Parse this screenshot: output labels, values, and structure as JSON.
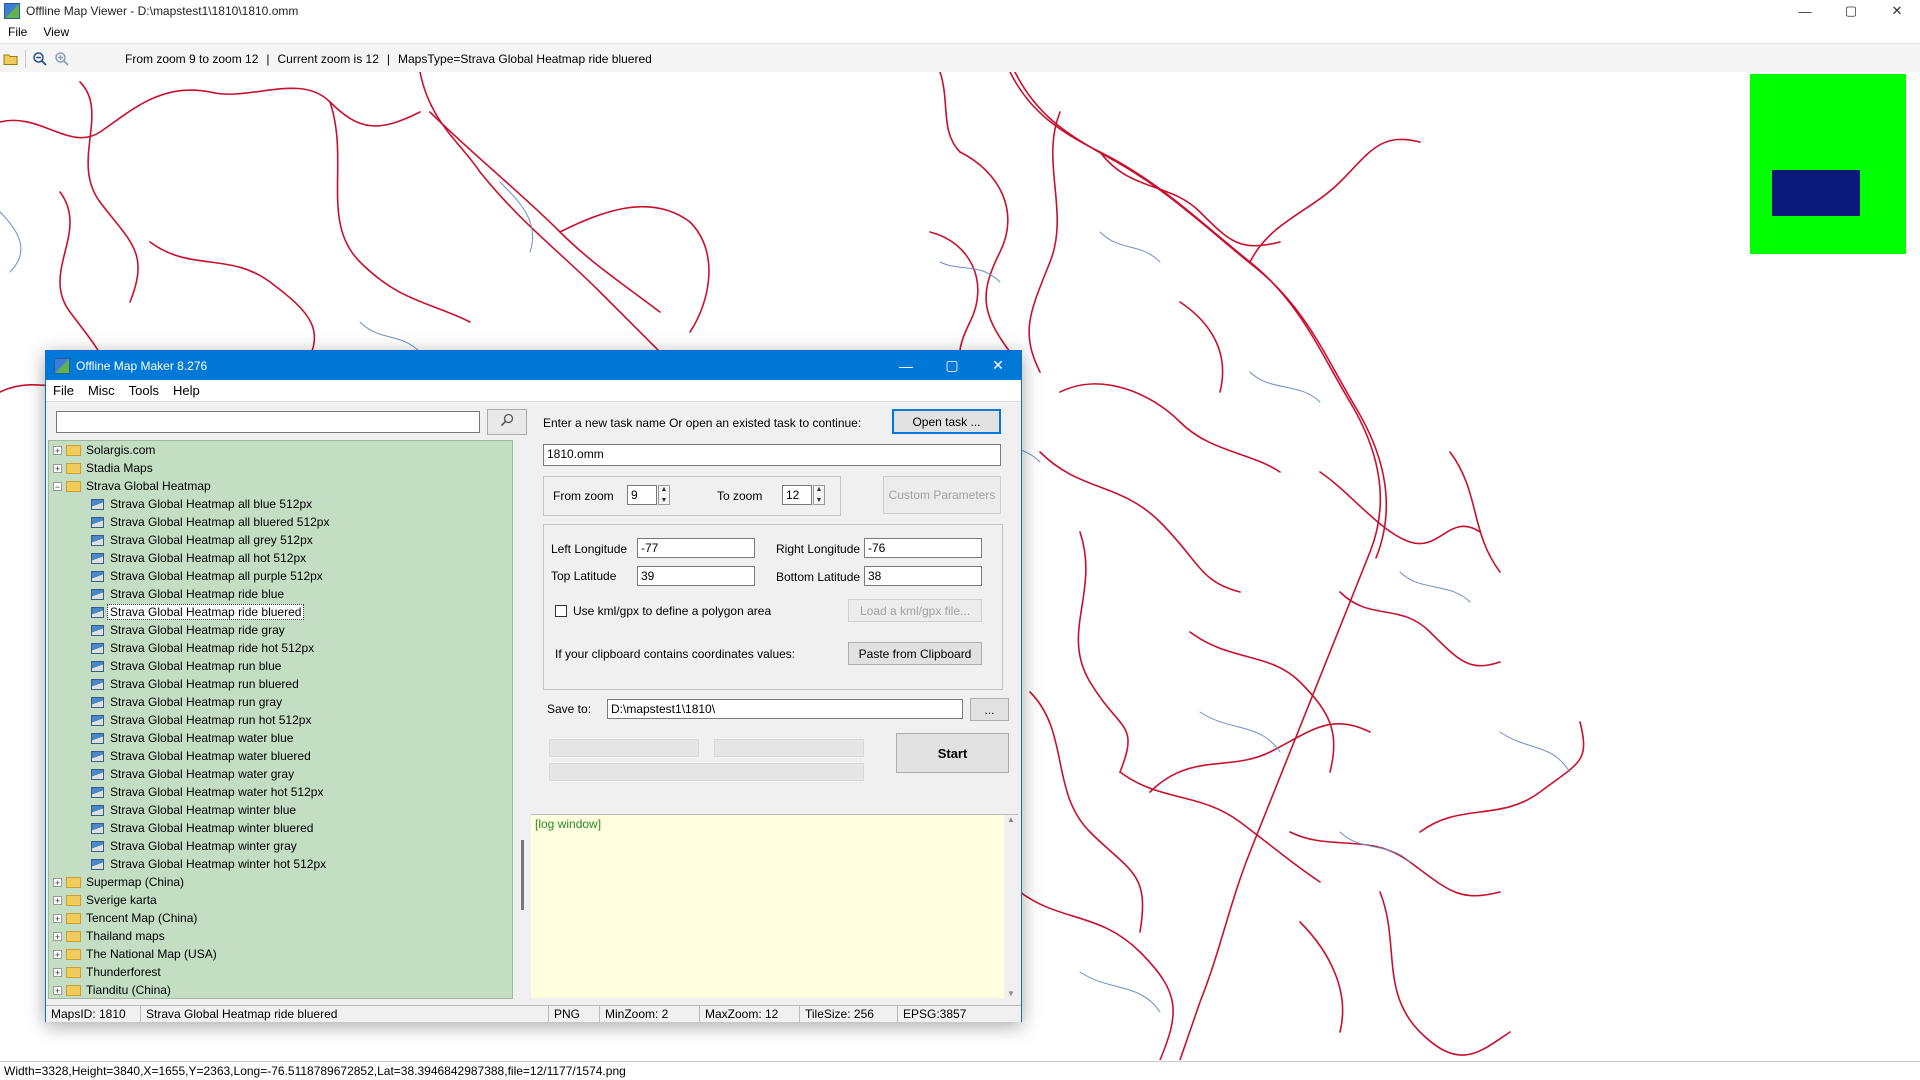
{
  "viewer": {
    "title": "Offline Map Viewer - D:\\mapstest1\\1810\\1810.omm",
    "menu": [
      "File",
      "View"
    ],
    "toolbar": {
      "zoom_range": "From zoom 9 to zoom 12",
      "current_zoom": "Current zoom is 12",
      "maps_type": "MapsType=Strava Global Heatmap ride bluered"
    },
    "status": "Width=3328,Height=3840,X=1655,Y=2363,Long=-76.5118789672852,Lat=38.3946842987388,file=12/1177/1574.png",
    "window_controls": [
      "—",
      "▢",
      "✕"
    ],
    "minimap_colors": {
      "background": "#00ff00",
      "viewport": "#0a1a7a"
    }
  },
  "dialog": {
    "title": "Offline Map Maker 8.276",
    "menu": [
      "File",
      "Misc",
      "Tools",
      "Help"
    ],
    "search": {
      "value": "",
      "icon": "search-icon"
    },
    "tree": [
      {
        "type": "folder",
        "label": "Solargis.com",
        "expanded": false
      },
      {
        "type": "folder",
        "label": "Stadia Maps",
        "expanded": false
      },
      {
        "type": "folder",
        "label": "Strava Global Heatmap",
        "expanded": true
      },
      {
        "type": "map",
        "label": "Strava Global Heatmap all blue 512px"
      },
      {
        "type": "map",
        "label": "Strava Global Heatmap all bluered 512px"
      },
      {
        "type": "map",
        "label": "Strava Global Heatmap all grey 512px"
      },
      {
        "type": "map",
        "label": "Strava Global Heatmap all hot 512px"
      },
      {
        "type": "map",
        "label": "Strava Global Heatmap all purple 512px"
      },
      {
        "type": "map",
        "label": "Strava Global Heatmap ride blue"
      },
      {
        "type": "map",
        "label": "Strava Global Heatmap ride bluered",
        "selected": true
      },
      {
        "type": "map",
        "label": "Strava Global Heatmap ride gray"
      },
      {
        "type": "map",
        "label": "Strava Global Heatmap ride hot 512px"
      },
      {
        "type": "map",
        "label": "Strava Global Heatmap run blue"
      },
      {
        "type": "map",
        "label": "Strava Global Heatmap run bluered"
      },
      {
        "type": "map",
        "label": "Strava Global Heatmap run gray"
      },
      {
        "type": "map",
        "label": "Strava Global Heatmap run hot 512px"
      },
      {
        "type": "map",
        "label": "Strava Global Heatmap water blue"
      },
      {
        "type": "map",
        "label": "Strava Global Heatmap water bluered"
      },
      {
        "type": "map",
        "label": "Strava Global Heatmap water gray"
      },
      {
        "type": "map",
        "label": "Strava Global Heatmap water hot 512px"
      },
      {
        "type": "map",
        "label": "Strava Global Heatmap winter blue"
      },
      {
        "type": "map",
        "label": "Strava Global Heatmap winter bluered"
      },
      {
        "type": "map",
        "label": "Strava Global Heatmap winter gray"
      },
      {
        "type": "map",
        "label": "Strava Global Heatmap winter hot 512px"
      },
      {
        "type": "folder",
        "label": "Supermap (China)",
        "expanded": false
      },
      {
        "type": "folder",
        "label": "Sverige karta",
        "expanded": false
      },
      {
        "type": "folder",
        "label": "Tencent Map (China)",
        "expanded": false
      },
      {
        "type": "folder",
        "label": "Thailand maps",
        "expanded": false
      },
      {
        "type": "folder",
        "label": "The National Map (USA)",
        "expanded": false
      },
      {
        "type": "folder",
        "label": "Thunderforest",
        "expanded": false
      },
      {
        "type": "folder",
        "label": "Tianditu (China)",
        "expanded": false
      }
    ],
    "task": {
      "prompt": "Enter a new task name Or open an existed task to continue:",
      "open_button": "Open task ...",
      "name": "1810.omm"
    },
    "zoom": {
      "from_label": "From zoom",
      "from_value": "9",
      "to_label": "To zoom",
      "to_value": "12",
      "custom_button": "Custom Parameters"
    },
    "coords": {
      "left_label": "Left Longitude",
      "left_value": "-77",
      "right_label": "Right Longitude",
      "right_value": "-76",
      "top_label": "Top Latitude",
      "top_value": "39",
      "bottom_label": "Bottom Latitude",
      "bottom_value": "38",
      "kml_label": "Use kml/gpx to define a polygon area",
      "kml_checked": false,
      "kml_button": "Load a kml/gpx file...",
      "clipboard_label": "If your clipboard contains coordinates values:",
      "clipboard_button": "Paste from Clipboard"
    },
    "save": {
      "label": "Save to:",
      "path": "D:\\mapstest1\\1810\\",
      "browse": "..."
    },
    "start_button": "Start",
    "log": "[log window]",
    "status": {
      "maps_id": "MapsID: 1810",
      "map_name": "Strava Global Heatmap ride bluered",
      "format": "PNG",
      "min_zoom": "MinZoom: 2",
      "max_zoom": "MaxZoom: 12",
      "tile_size": "TileSize: 256",
      "epsg": "EPSG:3857"
    }
  }
}
